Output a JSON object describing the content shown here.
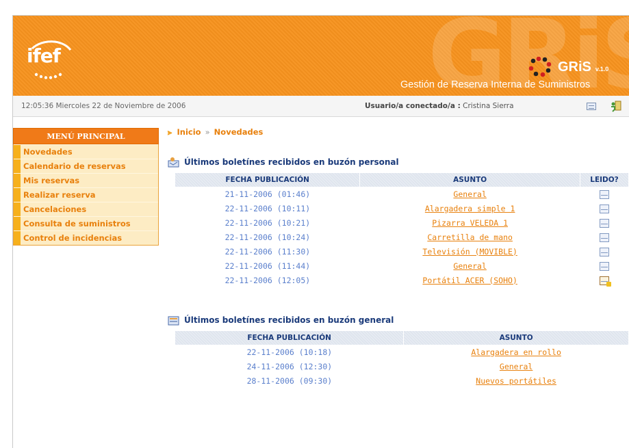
{
  "header": {
    "logo_text": "ifef",
    "app_name": "GRiS",
    "version": "v.1.0",
    "watermark": "GRiS",
    "subtitle": "Gestión de Reserva Interna de Suministros"
  },
  "infobar": {
    "datetime": "12:05:36  Miercoles 22 de Noviembre de 2006",
    "user_label": "Usuario/a conectado/a :",
    "user_name": "Cristina Sierra"
  },
  "menu": {
    "title": "MENÚ PRINCIPAL",
    "items": [
      {
        "label": "Novedades"
      },
      {
        "label": "Calendario de reservas"
      },
      {
        "label": "Mis reservas"
      },
      {
        "label": "Realizar reserva"
      },
      {
        "label": "Cancelaciones"
      },
      {
        "label": "Consulta de suministros"
      },
      {
        "label": "Control de incidencias"
      }
    ]
  },
  "breadcrumb": {
    "home": "Inicio",
    "separator": "»",
    "current": "Novedades"
  },
  "personal": {
    "title": "Últimos boletínes recibidos en buzón personal",
    "headers": {
      "date": "FECHA PUBLICACIÓN",
      "subject": "ASUNTO",
      "read": "LEIDO?"
    },
    "rows": [
      {
        "date": "21-11-2006 (01:46)",
        "subject": "General",
        "read": "read"
      },
      {
        "date": "22-11-2006 (10:11)",
        "subject": "Alargadera simple 1",
        "read": "read"
      },
      {
        "date": "22-11-2006 (10:21)",
        "subject": "Pizarra VELEDA 1",
        "read": "read"
      },
      {
        "date": "22-11-2006 (10:24)",
        "subject": "Carretilla de mano",
        "read": "read"
      },
      {
        "date": "22-11-2006 (11:30)",
        "subject": "Televisión (MOVIBLE)",
        "read": "read"
      },
      {
        "date": "22-11-2006 (11:44)",
        "subject": "General",
        "read": "read"
      },
      {
        "date": "22-11-2006 (12:05)",
        "subject": "Portátil ACER (SOHO)",
        "read": "unread"
      }
    ]
  },
  "general": {
    "title": "Últimos boletínes recibidos en buzón general",
    "headers": {
      "date": "FECHA PUBLICACIÓN",
      "subject": "ASUNTO"
    },
    "rows": [
      {
        "date": "22-11-2006 (10:18)",
        "subject": "Alargadera en rollo"
      },
      {
        "date": "24-11-2006 (12:30)",
        "subject": "General"
      },
      {
        "date": "28-11-2006 (09:30)",
        "subject": "Nuevos portátiles"
      }
    ]
  },
  "colors": {
    "brand_orange": "#f7931e",
    "menu_bg": "#fdecc4",
    "link": "#e8800c",
    "date_blue": "#5a7fcc",
    "heading_blue": "#1a3a7a"
  }
}
